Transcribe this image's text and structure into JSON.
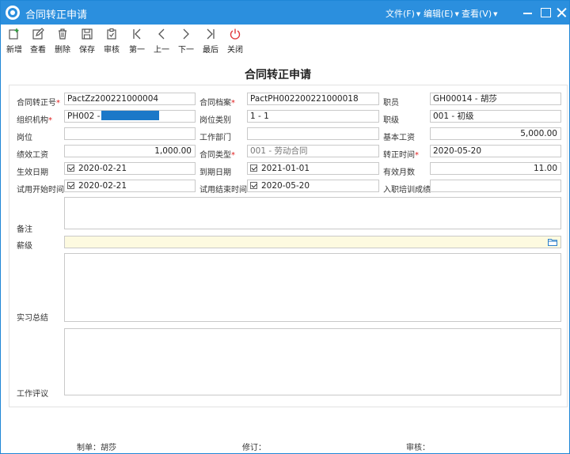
{
  "window": {
    "title": "合同转正申请",
    "menus": [
      "文件(F)",
      "编辑(E)",
      "查看(V)"
    ]
  },
  "toolbar": [
    "新增",
    "查看",
    "删除",
    "保存",
    "审核",
    "第一",
    "上一",
    "下一",
    "最后",
    "关闭"
  ],
  "form": {
    "title": "合同转正申请",
    "labels": {
      "contract_no": "合同转正号",
      "contract_file": "合同档案",
      "employee": "职员",
      "org": "组织机构",
      "post_type": "岗位类别",
      "rank": "职级",
      "post": "岗位",
      "work_dept": "工作部门",
      "base_salary": "基本工资",
      "perf_salary": "绩效工资",
      "contract_type": "合同类型",
      "confirm_time": "转正时间",
      "effective_date": "生效日期",
      "expiry_date": "到期日期",
      "valid_months": "有效月数",
      "trial_start": "试用开始时间",
      "trial_end": "试用结束时间",
      "training": "入职培训成绩",
      "remark": "备注",
      "salary_grade": "薪级",
      "intern_summary": "实习总结",
      "work_review": "工作评议"
    },
    "values": {
      "contract_no": "PactZz200221000004",
      "contract_file": "PactPH002200221000018",
      "employee": "GH00014 - 胡莎",
      "org": "PH002 -",
      "post_type": "1 - 1",
      "rank": "001 - 初级",
      "post": "",
      "work_dept": "",
      "base_salary": "5,000.00",
      "perf_salary": "1,000.00",
      "contract_type": "001 - 劳动合同",
      "confirm_time": "2020-05-20",
      "effective_date": "2020-02-21",
      "expiry_date": "2021-01-01",
      "valid_months": "11.00",
      "trial_start": "2020-02-21",
      "trial_end": "2020-05-20",
      "training": "",
      "remark": "",
      "salary_grade": "",
      "intern_summary": "",
      "work_review": ""
    }
  },
  "footer": {
    "maker": "制单：胡莎",
    "revise": "修订：",
    "audit": "审核："
  },
  "colors": {
    "titlebar": "#2b8fde",
    "required": "#e02020",
    "redaction": "#1b78c8",
    "salary_grade_bg": "#fdfae0"
  }
}
